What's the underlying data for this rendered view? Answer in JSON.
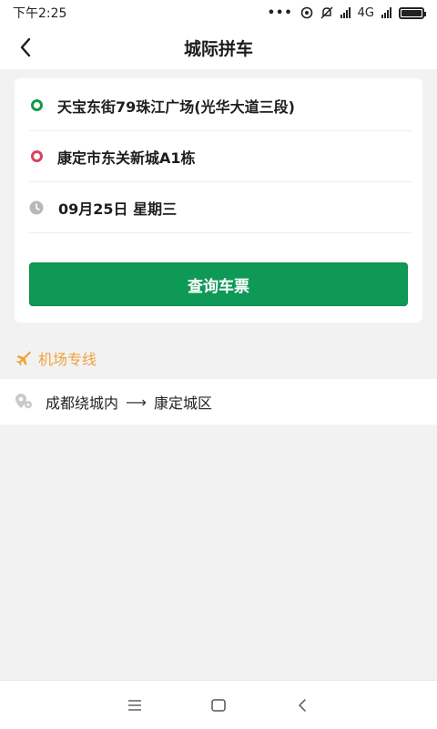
{
  "status_bar": {
    "time": "下午2:25",
    "dots": "•••",
    "network": "4G"
  },
  "header": {
    "title": "城际拼车"
  },
  "form": {
    "start_location": "天宝东街79珠江广场(光华大道三段)",
    "end_location": "康定市东关新城A1栋",
    "date": "09月25日 星期三",
    "search_button": "查询车票"
  },
  "section": {
    "label": "机场专线"
  },
  "route": {
    "from": "成都绕城内",
    "arrow": "⟶",
    "to": "康定城区"
  },
  "colors": {
    "primary_green": "#0f9957",
    "start_ring": "#16994d",
    "end_ring": "#d9425b",
    "section_orange": "#f2a03a"
  },
  "icons": [
    "back-arrow-icon",
    "green-ring-icon",
    "red-ring-icon",
    "clock-icon",
    "airplane-icon",
    "location-pin-icon",
    "menu-icon",
    "home-icon",
    "back-nav-icon"
  ]
}
